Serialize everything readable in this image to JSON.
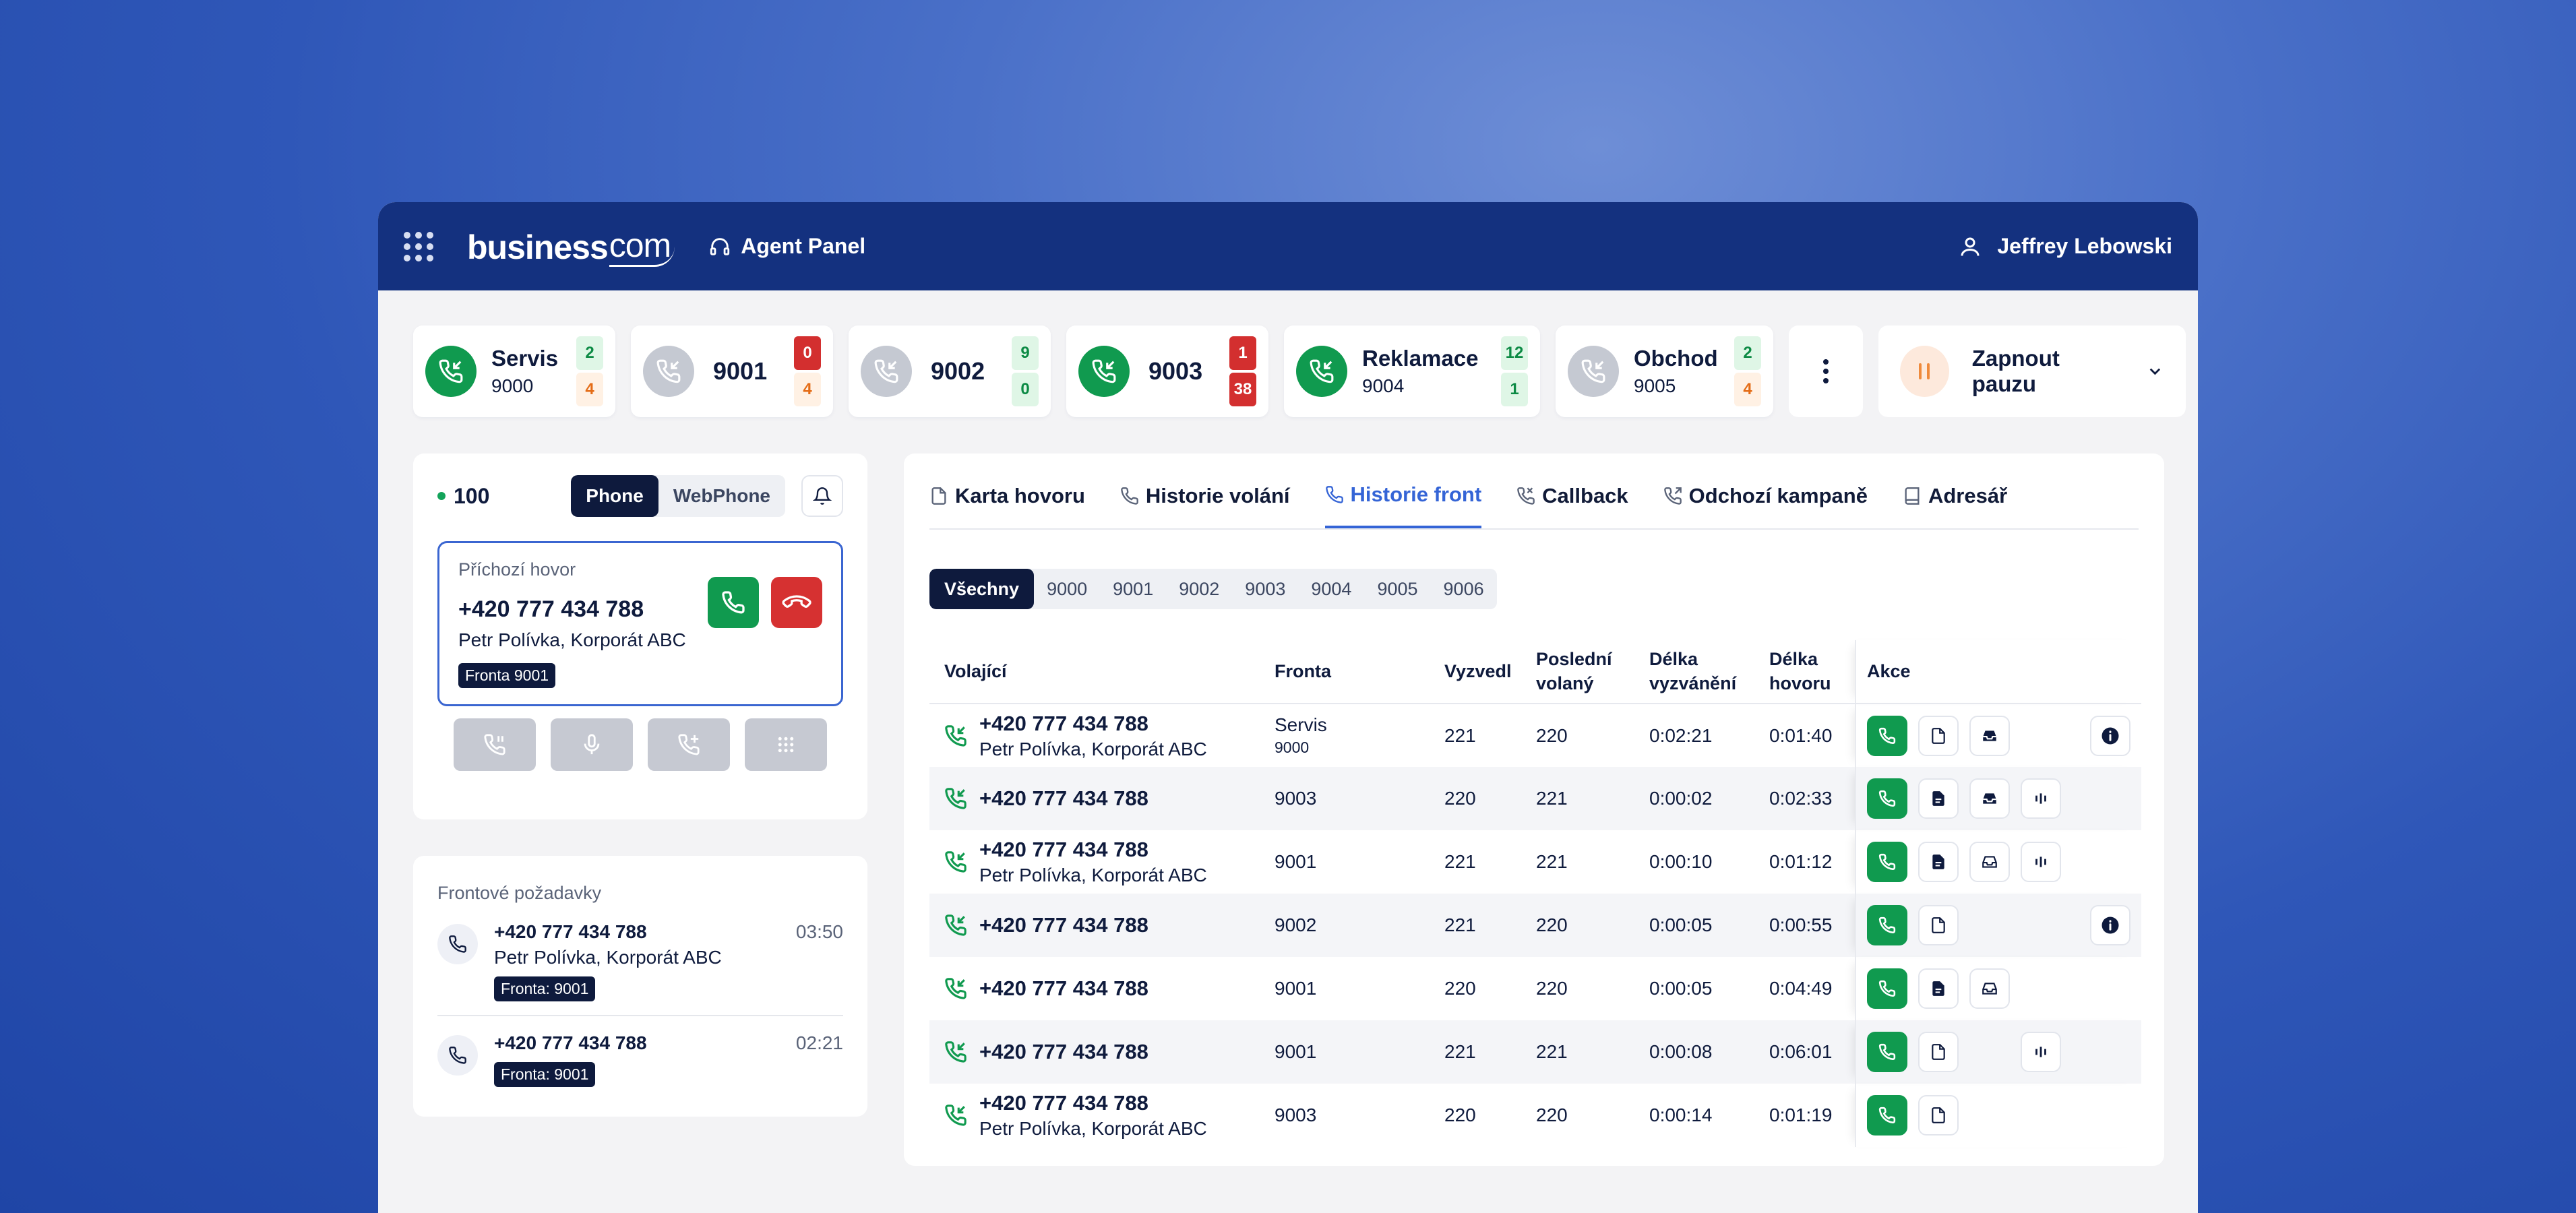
{
  "header": {
    "logo_main": "business",
    "logo_suffix": "com",
    "panel": "Agent Panel",
    "user": "Jeffrey Lebowski"
  },
  "queues": [
    {
      "name": "Servis",
      "number": "9000",
      "active": true,
      "top": "2",
      "bottom": "4",
      "top_style": "green",
      "bottom_style": "orange"
    },
    {
      "name": "9001",
      "number": "",
      "active": false,
      "top": "0",
      "bottom": "4",
      "top_style": "red",
      "bottom_style": "orange"
    },
    {
      "name": "9002",
      "number": "",
      "active": false,
      "top": "9",
      "bottom": "0",
      "top_style": "green",
      "bottom_style": "zero"
    },
    {
      "name": "9003",
      "number": "",
      "active": true,
      "top": "1",
      "bottom": "38",
      "top_style": "red",
      "bottom_style": "red"
    },
    {
      "name": "Reklamace",
      "number": "9004",
      "active": true,
      "top": "12",
      "bottom": "1",
      "top_style": "green",
      "bottom_style": "zero"
    },
    {
      "name": "Obchod",
      "number": "9005",
      "active": false,
      "top": "2",
      "bottom": "4",
      "top_style": "green",
      "bottom_style": "orange"
    }
  ],
  "pause": {
    "label": "Zapnout pauzu"
  },
  "phone": {
    "extension": "100",
    "modes": [
      "Phone",
      "WebPhone"
    ],
    "incoming_label": "Příchozí hovor",
    "incoming_number": "+420 777 434 788",
    "incoming_name": "Petr Polívka, Korporát ABC",
    "incoming_queue": "Fronta 9001"
  },
  "requests": {
    "title": "Frontové požadavky",
    "items": [
      {
        "number": "+420 777 434 788",
        "name": "Petr Polívka, Korporát ABC",
        "queue": "Fronta: 9001",
        "time": "03:50"
      },
      {
        "number": "+420 777 434 788",
        "name": "",
        "queue": "Fronta: 9001",
        "time": "02:21"
      }
    ]
  },
  "tabs": [
    "Karta hovoru",
    "Historie volání",
    "Historie front",
    "Callback",
    "Odchozí kampaně",
    "Adresář"
  ],
  "active_tab": "Historie front",
  "filters": [
    "Všechny",
    "9000",
    "9001",
    "9002",
    "9003",
    "9004",
    "9005",
    "9006"
  ],
  "table": {
    "headers": [
      "Volající",
      "Fronta",
      "Vyzvedl",
      "Poslední volaný",
      "Délka vyzvánění",
      "Délka hovoru",
      "Akce"
    ],
    "header_lines": {
      "posledni_1": "Poslední",
      "posledni_2": "volaný",
      "vyzv_1": "Délka",
      "vyzv_2": "vyzvánění",
      "hovor_1": "Délka",
      "hovor_2": "hovoru"
    },
    "rows": [
      {
        "number": "+420 777 434 788",
        "name": "Petr Polívka, Korporát ABC",
        "queue": "Servis",
        "queue_sub": "9000",
        "picked": "221",
        "last": "220",
        "ring": "0:02:21",
        "talk": "0:01:40"
      },
      {
        "number": "+420 777 434 788",
        "name": "",
        "queue": "9003",
        "queue_sub": "",
        "picked": "220",
        "last": "221",
        "ring": "0:00:02",
        "talk": "0:02:33"
      },
      {
        "number": "+420 777 434 788",
        "name": "Petr Polívka, Korporát ABC",
        "queue": "9001",
        "queue_sub": "",
        "picked": "221",
        "last": "221",
        "ring": "0:00:10",
        "talk": "0:01:12"
      },
      {
        "number": "+420 777 434 788",
        "name": "",
        "queue": "9002",
        "queue_sub": "",
        "picked": "221",
        "last": "220",
        "ring": "0:00:05",
        "talk": "0:00:55"
      },
      {
        "number": "+420 777 434 788",
        "name": "",
        "queue": "9001",
        "queue_sub": "",
        "picked": "220",
        "last": "220",
        "ring": "0:00:05",
        "talk": "0:04:49"
      },
      {
        "number": "+420 777 434 788",
        "name": "",
        "queue": "9001",
        "queue_sub": "",
        "picked": "221",
        "last": "221",
        "ring": "0:00:08",
        "talk": "0:06:01"
      },
      {
        "number": "+420 777 434 788",
        "name": "Petr Polívka, Korporát ABC",
        "queue": "9003",
        "queue_sub": "",
        "picked": "220",
        "last": "220",
        "ring": "0:00:14",
        "talk": "0:01:19"
      }
    ]
  },
  "colors": {
    "navy": "#14317f",
    "green": "#109a4f",
    "red": "#d63131",
    "accent": "#3464d6",
    "orange": "#e46c16"
  }
}
